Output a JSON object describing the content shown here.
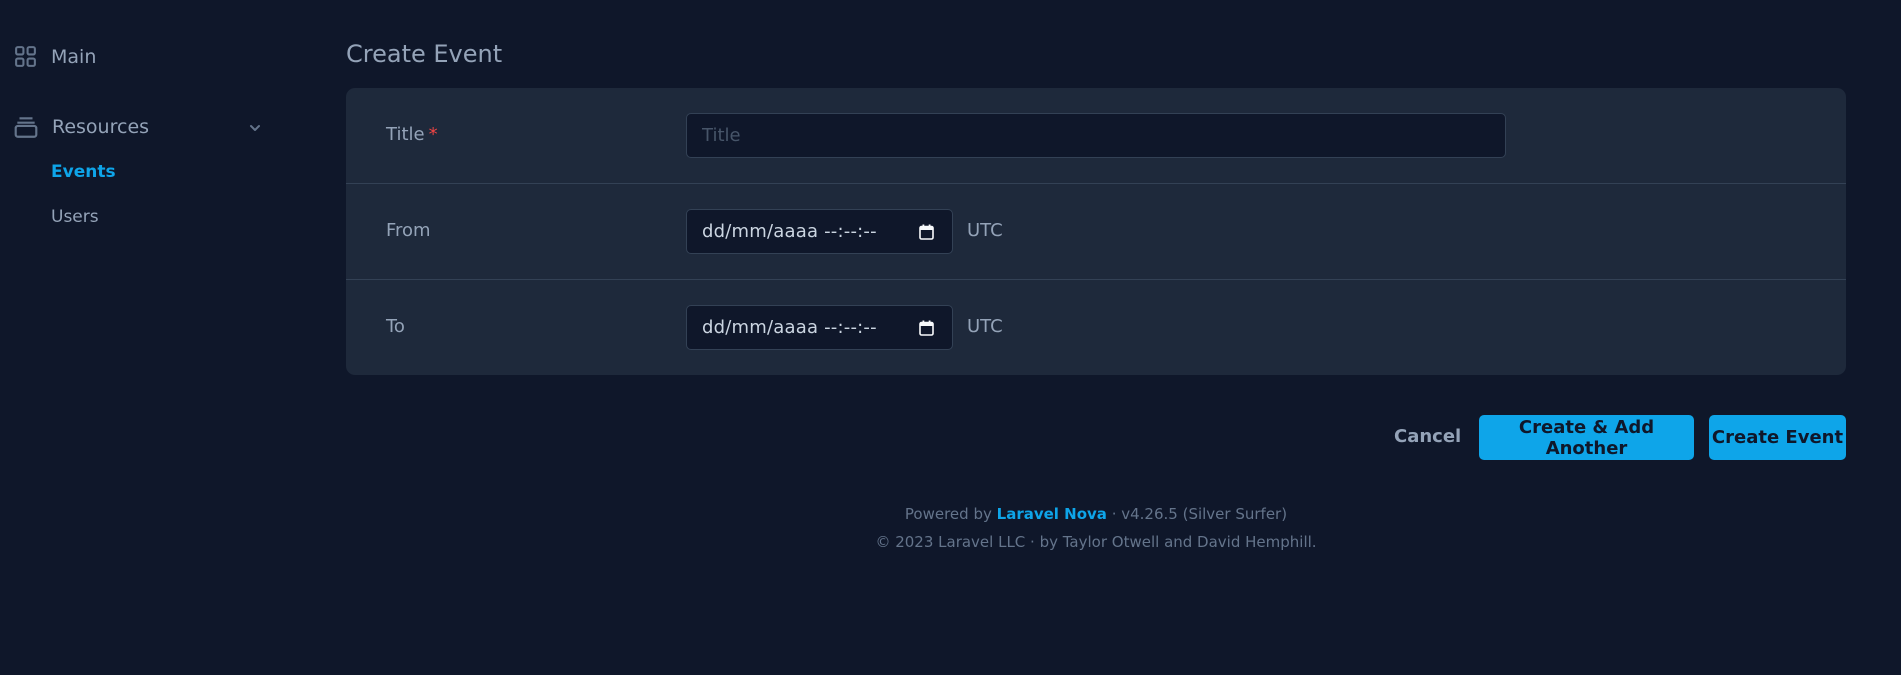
{
  "sidebar": {
    "main_label": "Main",
    "resources_label": "Resources",
    "items": [
      {
        "label": "Events",
        "active": true
      },
      {
        "label": "Users",
        "active": false
      }
    ]
  },
  "page": {
    "title": "Create Event"
  },
  "form": {
    "title": {
      "label": "Title",
      "required_mark": "*",
      "placeholder": "Title",
      "value": ""
    },
    "from": {
      "label": "From",
      "value": "dd/mm/aaaa --:--:--",
      "timezone": "UTC"
    },
    "to": {
      "label": "To",
      "value": "dd/mm/aaaa --:--:--",
      "timezone": "UTC"
    }
  },
  "actions": {
    "cancel": "Cancel",
    "create_add_another": "Create & Add Another",
    "create": "Create Event"
  },
  "footer": {
    "powered_by": "Powered by",
    "brand": "Laravel Nova",
    "version": "· v4.26.5 (Silver Surfer)",
    "copyright": "© 2023 Laravel LLC · by Taylor Otwell and David Hemphill."
  },
  "colors": {
    "background": "#0f172a",
    "card": "#1e293b",
    "accent": "#0ea5e9",
    "required": "#ef4444"
  },
  "icons": {
    "main": "grid-icon",
    "resources": "stack-icon",
    "expand": "chevron-down-icon",
    "calendar": "calendar-icon"
  }
}
